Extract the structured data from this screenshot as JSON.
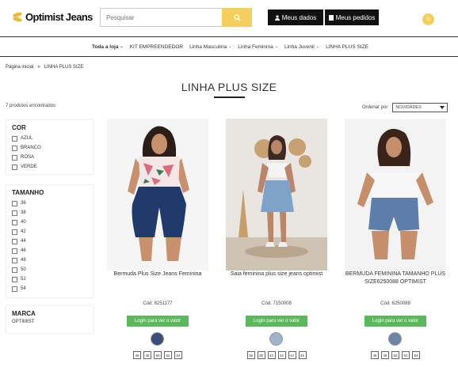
{
  "header": {
    "logo": "Optimist Jeans",
    "search_placeholder": "Pesquisar",
    "meus_dados": "Meus dados",
    "meus_pedidos": "Meus pedidos",
    "cart_count": "0"
  },
  "nav": [
    {
      "label": "Toda a loja",
      "chevron": true,
      "bold": true
    },
    {
      "label": "KIT EMPREENDEDOR",
      "chevron": false,
      "bold": false
    },
    {
      "label": "Linha Masculina",
      "chevron": true,
      "bold": false
    },
    {
      "label": "Linha Feminina",
      "chevron": true,
      "bold": false
    },
    {
      "label": "Linha Juvenil",
      "chevron": true,
      "bold": false
    },
    {
      "label": "LINHA PLUS SIZE",
      "chevron": false,
      "bold": false
    }
  ],
  "breadcrumb": {
    "home": "Página inicial",
    "sep": "»",
    "current": "LINHA PLUS SIZE"
  },
  "page_title": "LINHA PLUS SIZE",
  "count_text": "7 produtos encontrados",
  "sort": {
    "label": "Ordenar por",
    "value": "NOVIDADES"
  },
  "filters": {
    "cor": {
      "title": "COR",
      "options": [
        "AZUL",
        "BRANCO",
        "ROSA",
        "VERDE"
      ]
    },
    "tamanho": {
      "title": "TAMANHO",
      "options": [
        "36",
        "38",
        "40",
        "42",
        "44",
        "46",
        "48",
        "50",
        "52",
        "54"
      ]
    },
    "marca": {
      "title": "MARCA",
      "options": [
        "OPTIMIST"
      ]
    }
  },
  "products": [
    {
      "name": "Bermuda Plus Size Jeans Feminina",
      "cod": "Cód: 6251177",
      "button": "Login para ver o valor",
      "sizes": [
        "46",
        "48",
        "50",
        "52",
        "54"
      ]
    },
    {
      "name": "Saia feminina plus size jeans optimist",
      "cod": "Cód: 7150008",
      "button": "Login para ver o valor",
      "sizes": [
        "36",
        "38",
        "40",
        "42",
        "44",
        "46"
      ]
    },
    {
      "name": "BERMUDA FEMININA TAMANHO PLUS SIZE6250088 OPTIMIST",
      "cod": "Cód: 6250088",
      "button": "Login para ver o valor",
      "sizes": [
        "46",
        "48",
        "50",
        "52",
        "54"
      ]
    }
  ],
  "colors": {
    "accent": "#f5cf5c",
    "dark": "#111111",
    "green": "#5cb85c"
  }
}
